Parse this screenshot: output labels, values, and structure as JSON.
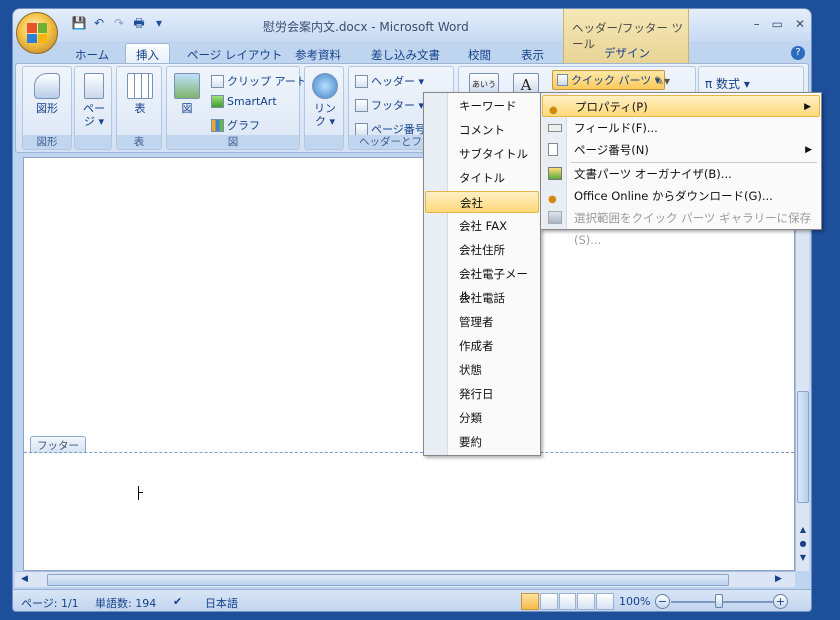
{
  "window": {
    "title": "慰労会案内文.docx - Microsoft Word",
    "context_tool_title": "ヘッダー/フッター ツール",
    "context_tab": "デザイン",
    "controls": {
      "minimize": "–",
      "maximize": "▭",
      "close": "✕"
    }
  },
  "quick_access": {
    "save": "💾",
    "undo": "↶",
    "redo": "↷",
    "print": "🖶",
    "more": "▾"
  },
  "tabs": [
    {
      "label": "ホーム"
    },
    {
      "label": "挿入",
      "active": true
    },
    {
      "label": "ページ レイアウト"
    },
    {
      "label": "参考資料"
    },
    {
      "label": "差し込み文書"
    },
    {
      "label": "校閲"
    },
    {
      "label": "表示"
    }
  ],
  "ribbon": {
    "groups": {
      "shapes": {
        "button": "図形",
        "label": "図形"
      },
      "pages": {
        "button": "ペー ジ ▾"
      },
      "table": {
        "button": "表",
        "label": "表"
      },
      "illustrations": {
        "picture": "図",
        "clipart": "クリップ アート",
        "smartart": "SmartArt",
        "chart": "グラフ",
        "label": "図"
      },
      "links": {
        "button": "リン ク ▾"
      },
      "header_footer": {
        "header": "ヘッダー ▾",
        "footer": "フッター ▾",
        "page_number": "ページ番号",
        "label": "ヘッダーとフッタ"
      },
      "text": {
        "quick_parts": "クイック パーツ ▾",
        "textbox_label": "あいうえ",
        "wordart": "A"
      },
      "symbols": {
        "equation": "π 数式 ▾"
      }
    }
  },
  "document": {
    "footer_tab": "フッター"
  },
  "quick_parts_menu": {
    "items": [
      {
        "label": "キーワード"
      },
      {
        "label": "コメント"
      },
      {
        "label": "サブタイトル"
      },
      {
        "label": "タイトル"
      },
      {
        "label": "会社",
        "highlighted": true
      },
      {
        "label": "会社 FAX"
      },
      {
        "label": "会社住所"
      },
      {
        "label": "会社電子メール"
      },
      {
        "label": "会社電話"
      },
      {
        "label": "管理者"
      },
      {
        "label": "作成者"
      },
      {
        "label": "状態"
      },
      {
        "label": "発行日"
      },
      {
        "label": "分類"
      },
      {
        "label": "要約"
      }
    ]
  },
  "parts_menu": {
    "items": [
      {
        "label": "プロパティ(P)",
        "highlighted": true,
        "submenu": true
      },
      {
        "label": "フィールド(F)..."
      },
      {
        "label": "ページ番号(N)",
        "submenu": true
      },
      {
        "label": "文書パーツ オーガナイザ(B)..."
      },
      {
        "label": "Office Online からダウンロード(G)..."
      },
      {
        "label": "選択範囲をクイック パーツ ギャラリーに保存(S)...",
        "disabled": true
      }
    ]
  },
  "status_bar": {
    "page": "ページ: 1/1",
    "words": "単語数: 194",
    "language": "日本語",
    "zoom": "100%"
  }
}
